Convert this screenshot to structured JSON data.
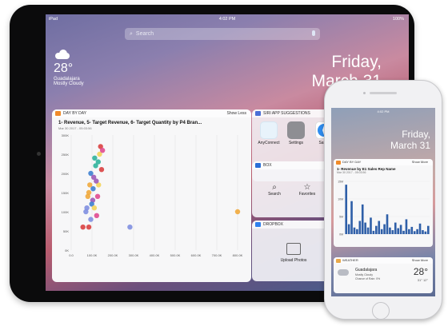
{
  "ipad": {
    "status": {
      "left": "iPad",
      "time": "4:02 PM",
      "battery": "100%"
    },
    "search_placeholder": "Search",
    "weather": {
      "temp": "28°",
      "city": "Guadalajara",
      "condition": "Mostly Cloudy"
    },
    "date": {
      "day": "Friday,",
      "date": "March 31"
    },
    "day_by_day": {
      "label": "DAY BY DAY",
      "action": "Show Less",
      "title": "1- Revenue, 5- Target Revenue, 6- Target Quantity by P4  Bran...",
      "subtitle": "Mar 30 2017 - 05:03:56"
    },
    "siri": {
      "label": "SIRI APP SUGGESTIONS",
      "apps": [
        {
          "name": "AnyConnect"
        },
        {
          "name": "Settings"
        },
        {
          "name": "Safari"
        }
      ]
    },
    "box": {
      "label": "BOX",
      "items": [
        {
          "name": "Search"
        },
        {
          "name": "Favorites"
        }
      ]
    },
    "dropbox": {
      "label": "DROPBOX",
      "item": "Upload Photos"
    }
  },
  "iphone": {
    "time": "4:02 PM",
    "date": {
      "day": "Friday,",
      "date": "March 31"
    },
    "day_by_day": {
      "label": "DAY BY DAY",
      "action": "Show More",
      "title": "1- Revenue by E1 Sales Rep Name",
      "subtitle": "Mar 30 2017 - 05:03:56"
    },
    "weather": {
      "label": "WEATHER",
      "action": "Show More",
      "city": "Guadalajara",
      "condition": "Mostly Cloudy",
      "rain": "Chance of Rain: 0%",
      "temp": "28°",
      "range": "31° 12°"
    }
  },
  "chart_data": [
    {
      "type": "scatter",
      "title": "1- Revenue, 5- Target Revenue, 6- Target Quantity by P4  Bran...",
      "ylabels": [
        "300K",
        "250K",
        "200K",
        "150K",
        "100K",
        "50K",
        "0K"
      ],
      "xlabels": [
        "0.0",
        "100.0K",
        "200.0K",
        "300.0K",
        "400.0K",
        "500.0K",
        "600.0K",
        "700.0K",
        "800.0K"
      ],
      "ylim": [
        0,
        300000
      ],
      "xlim": [
        0,
        850000
      ],
      "colors": [
        "#d94040",
        "#7f8fe0",
        "#f0a93c",
        "#3e7fd0",
        "#9b59b6",
        "#2fb39b",
        "#e04a8f",
        "#f3d35a"
      ],
      "series": [
        {
          "name": "",
          "points": [
            [
              60000,
              60000
            ],
            [
              80000,
              110000
            ],
            [
              90000,
              150000
            ],
            [
              100000,
              200000
            ],
            [
              110000,
              130000
            ],
            [
              120000,
              240000
            ],
            [
              130000,
              90000
            ],
            [
              140000,
              170000
            ],
            [
              150000,
              270000
            ],
            [
              100000,
              80000
            ],
            [
              95000,
              170000
            ],
            [
              105000,
              120000
            ],
            [
              115000,
              190000
            ],
            [
              125000,
              220000
            ],
            [
              135000,
              140000
            ],
            [
              145000,
              250000
            ],
            [
              155000,
              210000
            ],
            [
              75000,
              100000
            ],
            [
              85000,
              140000
            ],
            [
              112000,
              160000
            ],
            [
              128000,
              180000
            ],
            [
              138000,
              230000
            ],
            [
              160000,
              260000
            ],
            [
              118000,
              110000
            ],
            [
              90000,
              60000
            ],
            [
              300000,
              60000
            ],
            [
              850000,
              100000
            ]
          ]
        }
      ]
    },
    {
      "type": "bar",
      "title": "1- Revenue by E1 Sales Rep Name",
      "ylabels": [
        "15M",
        "10M",
        "5M",
        "0M"
      ],
      "ylim": [
        0,
        16000000
      ],
      "values": [
        15000000,
        3000000,
        10000000,
        2000000,
        1500000,
        4000000,
        9000000,
        3500000,
        2000000,
        5000000,
        1000000,
        2500000,
        4000000,
        1500000,
        3000000,
        6000000,
        2000000,
        1200000,
        3500000,
        1800000,
        2800000,
        1000000,
        4500000,
        1500000,
        2200000,
        900000,
        1500000,
        3200000,
        1200000,
        800000,
        2500000
      ]
    }
  ]
}
